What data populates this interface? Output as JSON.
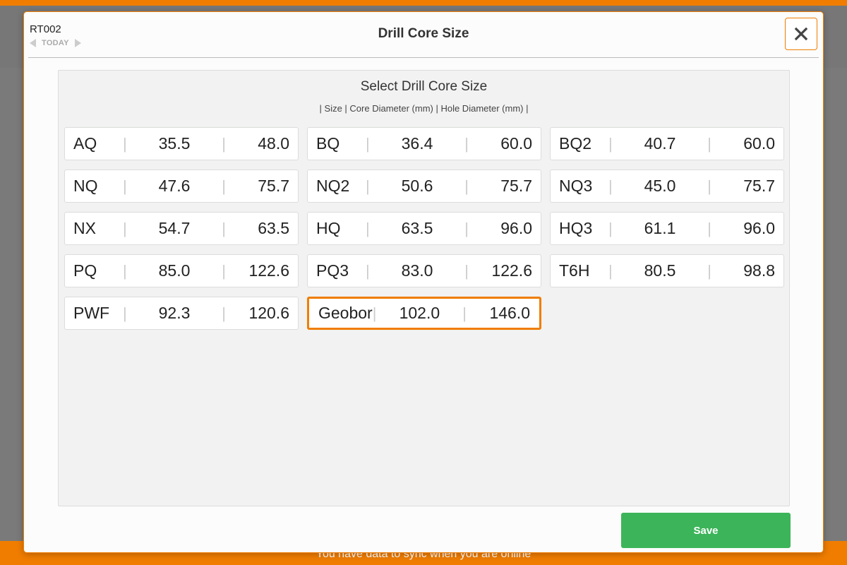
{
  "background": {
    "sync_message": "You have data to sync when you are online"
  },
  "modal": {
    "id": "RT002",
    "date_label": "TODAY",
    "title": "Drill Core Size",
    "close_icon": "close-icon"
  },
  "panel": {
    "title": "Select Drill Core Size",
    "subtitle": "| Size | Core Diameter (mm) | Hole Diameter (mm) |"
  },
  "sizes": [
    {
      "size": "AQ",
      "core": "35.5",
      "hole": "48.0"
    },
    {
      "size": "BQ",
      "core": "36.4",
      "hole": "60.0"
    },
    {
      "size": "BQ2",
      "core": "40.7",
      "hole": "60.0"
    },
    {
      "size": "NQ",
      "core": "47.6",
      "hole": "75.7"
    },
    {
      "size": "NQ2",
      "core": "50.6",
      "hole": "75.7"
    },
    {
      "size": "NQ3",
      "core": "45.0",
      "hole": "75.7"
    },
    {
      "size": "NX",
      "core": "54.7",
      "hole": "63.5"
    },
    {
      "size": "HQ",
      "core": "63.5",
      "hole": "96.0"
    },
    {
      "size": "HQ3",
      "core": "61.1",
      "hole": "96.0"
    },
    {
      "size": "PQ",
      "core": "85.0",
      "hole": "122.6"
    },
    {
      "size": "PQ3",
      "core": "83.0",
      "hole": "122.6"
    },
    {
      "size": "T6H",
      "core": "80.5",
      "hole": "98.8"
    },
    {
      "size": "PWF",
      "core": "92.3",
      "hole": "120.6"
    },
    {
      "size": "Geobor",
      "core": "102.0",
      "hole": "146.0"
    }
  ],
  "selected_size": "Geobor",
  "separator": "|",
  "footer": {
    "save_label": "Save"
  },
  "colors": {
    "accent": "#f07d00",
    "save": "#3cb45a"
  }
}
